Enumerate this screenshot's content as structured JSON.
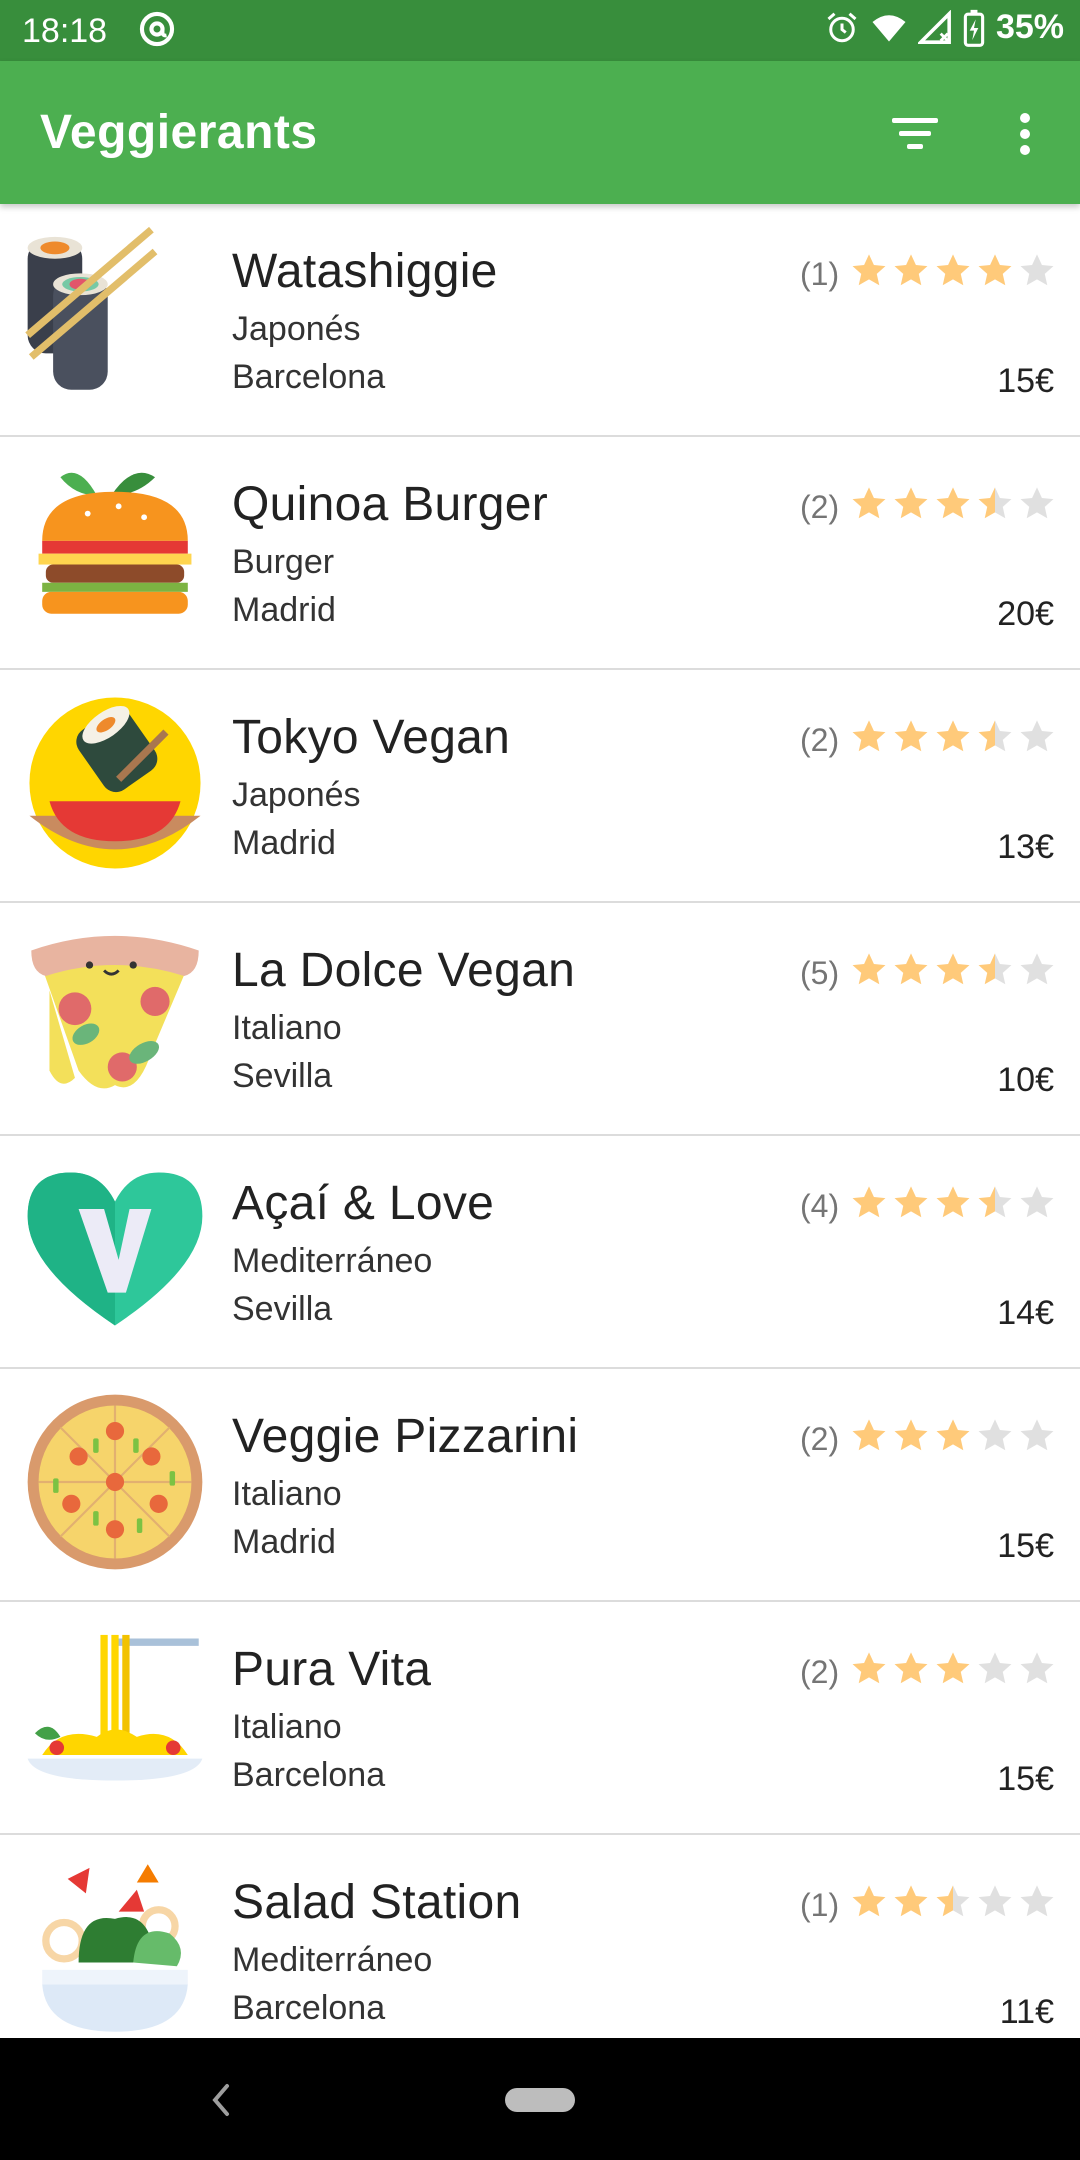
{
  "status_bar": {
    "time": "18:18",
    "battery": "35%",
    "icons": [
      "at-sign-icon",
      "alarm-icon",
      "wifi-icon",
      "signal-icon",
      "battery-charging-icon"
    ]
  },
  "app_bar": {
    "title": "Veggierants",
    "actions": [
      "filter-icon",
      "more-vert-icon"
    ]
  },
  "colors": {
    "status_bar": "#388e3c",
    "app_bar": "#4caf50",
    "star_filled": "#ffca7a",
    "star_empty": "#e0e0e0"
  },
  "restaurants": [
    {
      "name": "Watashiggie",
      "cuisine": "Japonés",
      "city": "Barcelona",
      "reviews": "(1)",
      "rating": 4,
      "price": "15€",
      "icon": "sushi-icon"
    },
    {
      "name": "Quinoa Burger",
      "cuisine": "Burger",
      "city": "Madrid",
      "reviews": "(2)",
      "rating": 3.5,
      "price": "20€",
      "icon": "burger-icon"
    },
    {
      "name": "Tokyo Vegan",
      "cuisine": "Japonés",
      "city": "Madrid",
      "reviews": "(2)",
      "rating": 3.5,
      "price": "13€",
      "icon": "sushi-bowl-icon"
    },
    {
      "name": "La Dolce Vegan",
      "cuisine": "Italiano",
      "city": "Sevilla",
      "reviews": "(5)",
      "rating": 3.5,
      "price": "10€",
      "icon": "pizza-slice-icon"
    },
    {
      "name": "Açaí & Love",
      "cuisine": "Mediterráneo",
      "city": "Sevilla",
      "reviews": "(4)",
      "rating": 3.5,
      "price": "14€",
      "icon": "vegan-heart-icon"
    },
    {
      "name": "Veggie Pizzarini",
      "cuisine": "Italiano",
      "city": "Madrid",
      "reviews": "(2)",
      "rating": 3,
      "price": "15€",
      "icon": "pizza-icon"
    },
    {
      "name": "Pura Vita",
      "cuisine": "Italiano",
      "city": "Barcelona",
      "reviews": "(2)",
      "rating": 3,
      "price": "15€",
      "icon": "spaghetti-icon"
    },
    {
      "name": "Salad Station",
      "cuisine": "Mediterráneo",
      "city": "Barcelona",
      "reviews": "(1)",
      "rating": 2.5,
      "price": "11€",
      "icon": "salad-icon"
    }
  ],
  "nav_bar": {
    "icons": [
      "back-icon",
      "home-pill-icon"
    ]
  }
}
